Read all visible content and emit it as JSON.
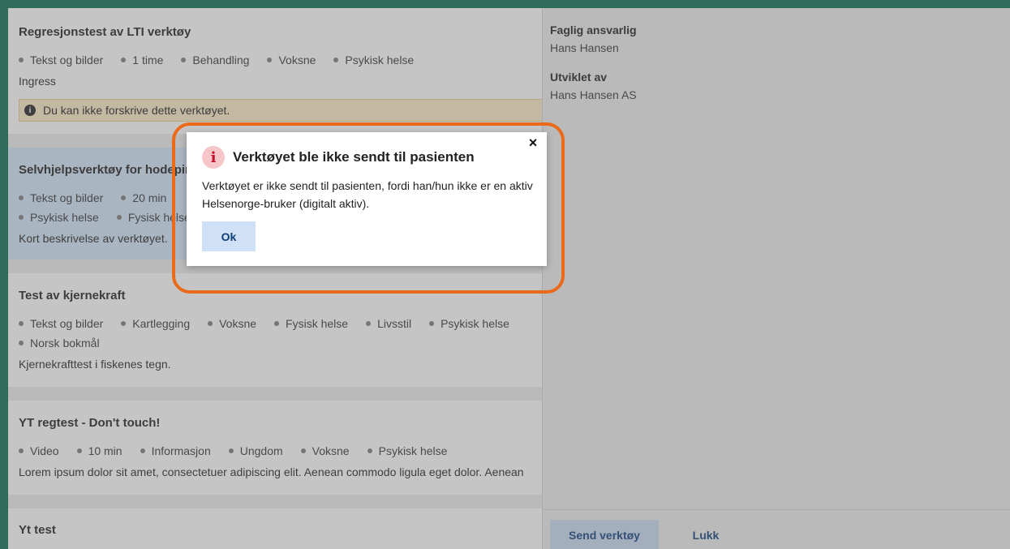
{
  "list": {
    "cards": [
      {
        "title": "Regresjonstest av LTI verktøy",
        "tags": [
          "Tekst og bilder",
          "1 time",
          "Behandling",
          "Voksne",
          "Psykisk helse"
        ],
        "description": "Ingress",
        "warning": "Du kan ikke forskrive dette verktøyet."
      },
      {
        "title": "Selvhjelpsverktøy for hodepine",
        "tags": [
          "Tekst og bilder",
          "20 min",
          "Psykisk helse",
          "Fysisk helse"
        ],
        "description": "Kort beskrivelse av verktøyet."
      },
      {
        "title": "Test av kjernekraft",
        "tags": [
          "Tekst og bilder",
          "Kartlegging",
          "Voksne",
          "Fysisk helse",
          "Livsstil",
          "Psykisk helse",
          "Norsk bokmål"
        ],
        "description": "Kjernekrafttest i fiskenes tegn."
      },
      {
        "title": "YT regtest - Don't touch!",
        "tags": [
          "Video",
          "10 min",
          "Informasjon",
          "Ungdom",
          "Voksne",
          "Psykisk helse"
        ],
        "description": "Lorem ipsum dolor sit amet, consectetuer adipiscing elit. Aenean commodo ligula eget dolor. Aenean"
      },
      {
        "title": "Yt test"
      }
    ]
  },
  "details": {
    "responsible_label": "Faglig ansvarlig",
    "responsible_value": "Hans Hansen",
    "developer_label": "Utviklet av",
    "developer_value": "Hans Hansen AS",
    "send_button": "Send verktøy",
    "close_button": "Lukk"
  },
  "modal": {
    "icon": "info-icon",
    "title": "Verktøyet ble ikke sendt til pasienten",
    "text": "Verktøyet er ikke sendt til pasienten, fordi han/hun ikke er en aktiv Helsenorge-bruker (digitalt aktiv).",
    "ok_button": "Ok",
    "close_symbol": "×"
  },
  "colors": {
    "accent_border": "#0a6b52",
    "highlight": "#ea6a1a",
    "button_bg": "#cfe0f7",
    "button_text": "#0f3e78"
  }
}
